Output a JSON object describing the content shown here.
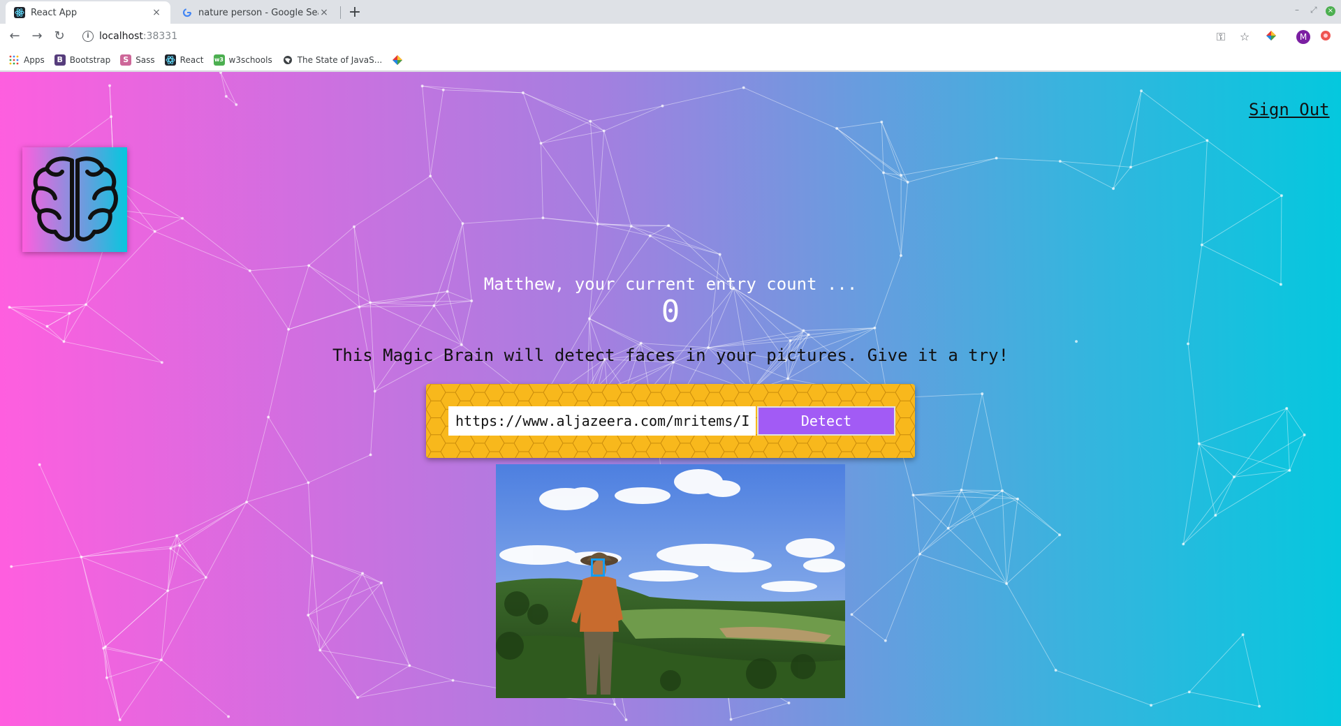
{
  "browser": {
    "tabs": [
      {
        "title": "React App",
        "close": "×"
      },
      {
        "title": "nature person - Google Search",
        "close": "×"
      }
    ],
    "new_tab": "+",
    "nav": {
      "back": "←",
      "forward": "→",
      "reload": "↻"
    },
    "address": {
      "host": "localhost",
      "port": ":38331"
    },
    "bookmarks": [
      {
        "label": "Apps",
        "icon": "apps-grid-icon"
      },
      {
        "label": "Bootstrap",
        "icon": "bootstrap-icon",
        "glyph": "B"
      },
      {
        "label": "Sass",
        "icon": "sass-icon",
        "glyph": "S"
      },
      {
        "label": "React",
        "icon": "react-icon"
      },
      {
        "label": "w3schools",
        "icon": "w3schools-icon"
      },
      {
        "label": "The State of JavaS...",
        "icon": "globe-icon"
      }
    ],
    "profile_initial": "M",
    "colors": {
      "tabstrip": "#dee1e6",
      "avatar": "#7b1fa2"
    }
  },
  "app": {
    "sign_out": "Sign Out",
    "greeting": "Matthew, your current entry count ...",
    "entry_count": "0",
    "tagline": "This Magic Brain will detect faces in your pictures. Give it a try!",
    "url_input_value": "https://www.aljazeera.com/mritems/Ima",
    "detect_label": "Detect",
    "colors": {
      "gradient_start": "#ff5edf",
      "gradient_end": "#04c8de",
      "detect_button": "#a25bf5",
      "form_pattern": "#f8b81c",
      "face_box": "#149df2"
    }
  }
}
